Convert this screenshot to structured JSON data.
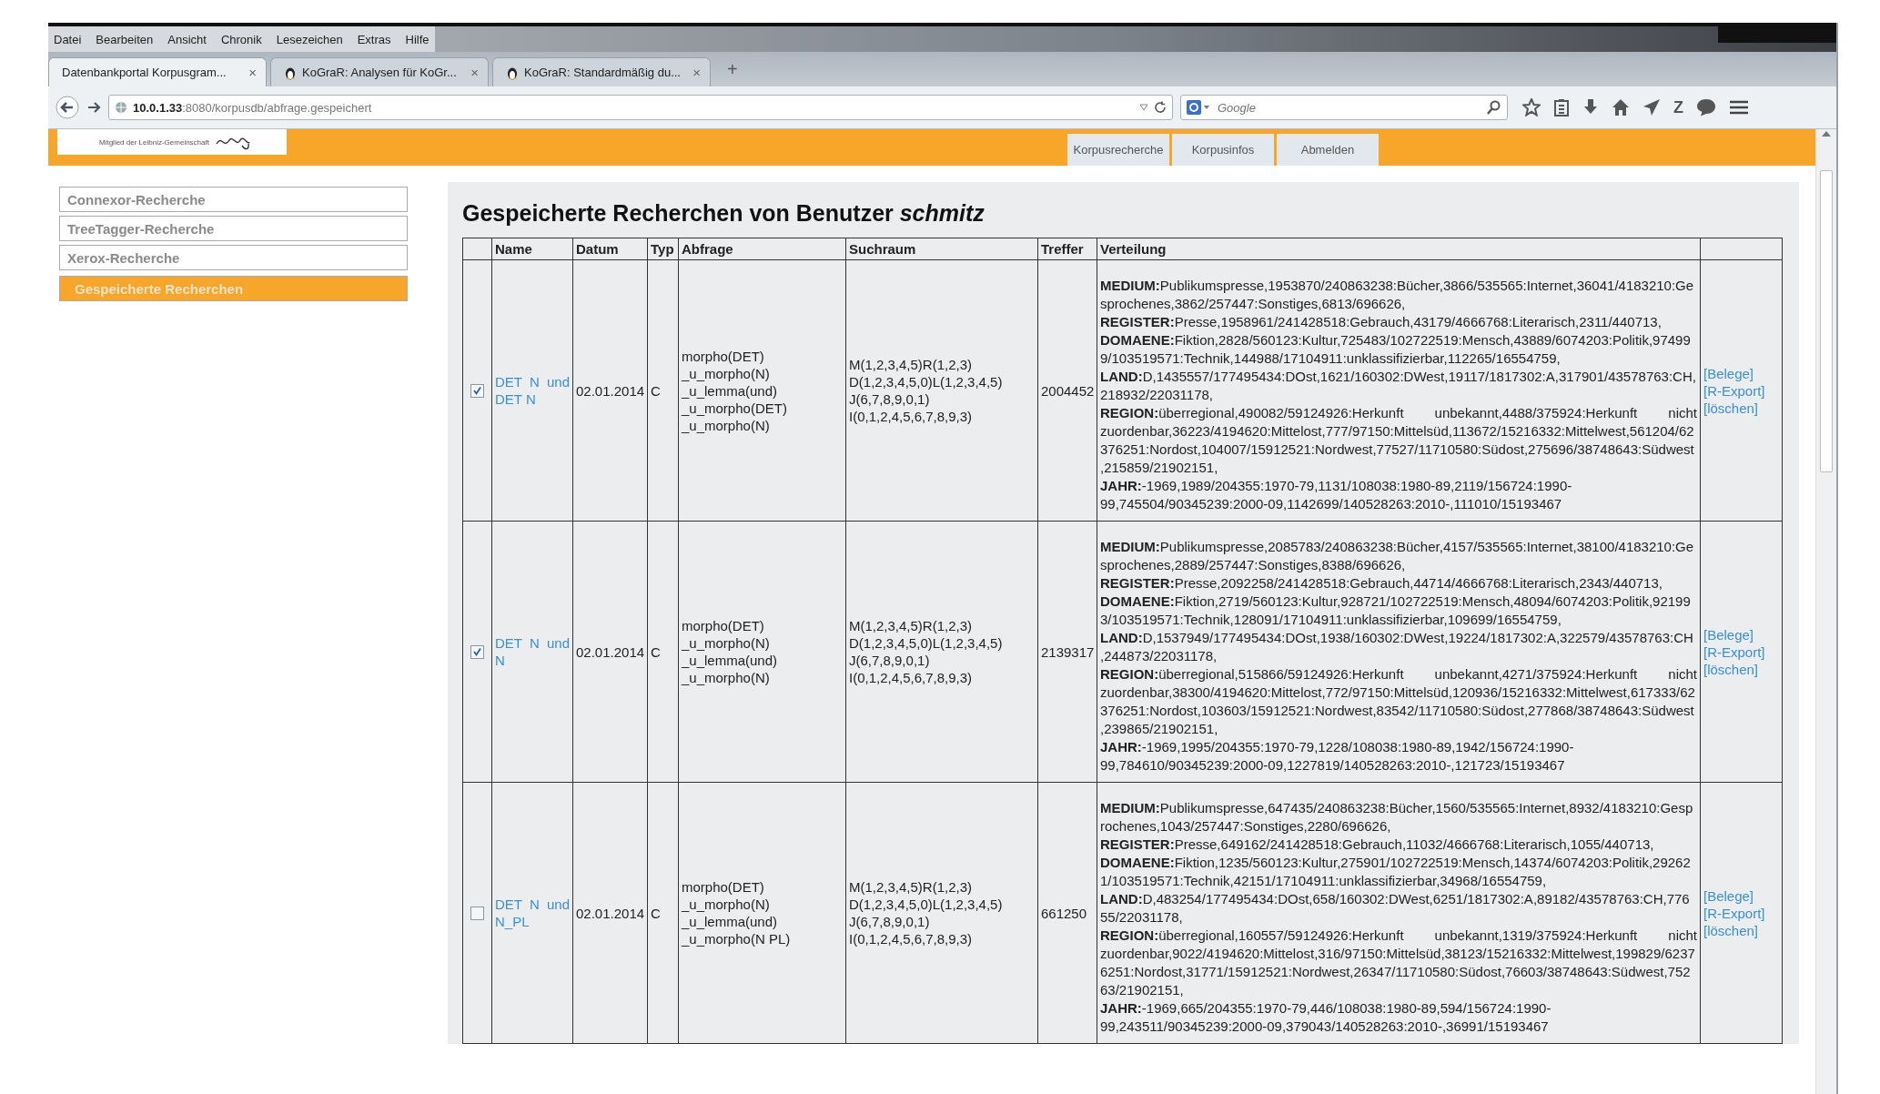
{
  "browser": {
    "menu": [
      "Datei",
      "Bearbeiten",
      "Ansicht",
      "Chronik",
      "Lesezeichen",
      "Extras",
      "Hilfe"
    ],
    "tabs": [
      {
        "title": "Datenbankportal Korpusgram...",
        "close": "×",
        "selected": true,
        "favicon": false
      },
      {
        "title": "KoGraR: Analysen für KoGr...",
        "close": "×",
        "selected": false,
        "favicon": true
      },
      {
        "title": "KoGraR: Standardmäßig du...",
        "close": "×",
        "selected": false,
        "favicon": true
      }
    ],
    "new_tab": "+",
    "url": {
      "host": "10.0.1.33",
      "path": ":8080/korpusdb/abfrage.gespeichert"
    },
    "search": {
      "placeholder": "Google"
    },
    "addon_label": "Z"
  },
  "header": {
    "logo_caption": "Mitglied der Leibniz-Gemeinschaft",
    "nav": [
      "Korpusrecherche",
      "Korpusinfos",
      "Abmelden"
    ]
  },
  "sidebar": {
    "items": [
      {
        "label": "Connexor-Recherche",
        "selected": false
      },
      {
        "label": "TreeTagger-Recherche",
        "selected": false
      },
      {
        "label": "Xerox-Recherche",
        "selected": false
      },
      {
        "label": "Gespeicherte Recherchen",
        "selected": true
      }
    ]
  },
  "page": {
    "title": "Gespeicherte Recherchen von Benutzer *schmitz*"
  },
  "table": {
    "columns": [
      "Name",
      "Datum",
      "Typ",
      "Abfrage",
      "Suchraum",
      "Treffer",
      "Verteilung"
    ],
    "rows": [
      {
        "checked": true,
        "name": "DET N und DET N",
        "datum": "02.01.2014",
        "typ": "C",
        "abfrage": [
          "morpho(DET)",
          "_u_morpho(N)",
          "_u_lemma(und)",
          "_u_morpho(DET)",
          "_u_morpho(N)"
        ],
        "suchraum": [
          "M(1,2,3,4,5)R(1,2,3)",
          "D(1,2,3,4,5,0)L(1,2,3,4,5)",
          "J(6,7,8,9,0,1)",
          "I(0,1,2,4,5,6,7,8,9,3)"
        ],
        "treffer": "2004452",
        "verteilung": [
          "**MEDIUM:**Publikumspresse,1953870/240863238:Bücher,3866/535565:Internet,36041/4183210:Gesprochenes,3862/257447:Sonstiges,6813/696626,",
          "**REGISTER:**Presse,1958961/241428518:Gebrauch,43179/4666768:Literarisch,2311/440713,",
          "**DOMAENE:**Fiktion,2828/560123:Kultur,725483/102722519:Mensch,43889/6074203:Politik,974999/103519571:Technik,144988/17104911:unklassifizierbar,112265/16554759,",
          "**LAND:**D,1435557/177495434:DOst,1621/160302:DWest,19117/1817302:A,317901/43578763:CH,218932/22031178,",
          "**REGION:**überregional,490082/59124926:Herkunft unbekannt,4488/375924:Herkunft nicht zuordenbar,36223/4194620:Mittelost,777/97150:Mittelsüd,113672/15216332:Mittelwest,561204/62376251:Nordost,104007/15912521:Nordwest,77527/11710580:Südost,275696/38748643:Südwest,215859/21902151,",
          "**JAHR:**-1969,1989/204355:1970-79,1131/108038:1980-89,2119/156724:1990-99,745504/90345239:2000-09,1142699/140528263:2010-,111010/15193467"
        ],
        "actions": [
          "[Belege]",
          "[R-Export]",
          "[löschen]"
        ]
      },
      {
        "checked": true,
        "name": "DET N und N",
        "datum": "02.01.2014",
        "typ": "C",
        "abfrage": [
          "morpho(DET)",
          "_u_morpho(N)",
          "_u_lemma(und)",
          "_u_morpho(N)"
        ],
        "suchraum": [
          "M(1,2,3,4,5)R(1,2,3)",
          "D(1,2,3,4,5,0)L(1,2,3,4,5)",
          "J(6,7,8,9,0,1)",
          "I(0,1,2,4,5,6,7,8,9,3)"
        ],
        "treffer": "2139317",
        "verteilung": [
          "**MEDIUM:**Publikumspresse,2085783/240863238:Bücher,4157/535565:Internet,38100/4183210:Gesprochenes,2889/257447:Sonstiges,8388/696626,",
          "**REGISTER:**Presse,2092258/241428518:Gebrauch,44714/4666768:Literarisch,2343/440713,",
          "**DOMAENE:**Fiktion,2719/560123:Kultur,928721/102722519:Mensch,48094/6074203:Politik,921993/103519571:Technik,128091/17104911:unklassifizierbar,109699/16554759,",
          "**LAND:**D,1537949/177495434:DOst,1938/160302:DWest,19224/1817302:A,322579/43578763:CH,244873/22031178,",
          "**REGION:**überregional,515866/59124926:Herkunft unbekannt,4271/375924:Herkunft nicht zuordenbar,38300/4194620:Mittelost,772/97150:Mittelsüd,120936/15216332:Mittelwest,617333/62376251:Nordost,103603/15912521:Nordwest,83542/11710580:Südost,277868/38748643:Südwest,239865/21902151,",
          "**JAHR:**-1969,1995/204355:1970-79,1228/108038:1980-89,1942/156724:1990-99,784610/90345239:2000-09,1227819/140528263:2010-,121723/15193467"
        ],
        "actions": [
          "[Belege]",
          "[R-Export]",
          "[löschen]"
        ]
      },
      {
        "checked": false,
        "name": "DET N und N_PL",
        "datum": "02.01.2014",
        "typ": "C",
        "abfrage": [
          "morpho(DET)",
          "_u_morpho(N)",
          "_u_lemma(und)",
          "_u_morpho(N PL)"
        ],
        "suchraum": [
          "M(1,2,3,4,5)R(1,2,3)",
          "D(1,2,3,4,5,0)L(1,2,3,4,5)",
          "J(6,7,8,9,0,1)",
          "I(0,1,2,4,5,6,7,8,9,3)"
        ],
        "treffer": "661250",
        "verteilung": [
          "**MEDIUM:**Publikumspresse,647435/240863238:Bücher,1560/535565:Internet,8932/4183210:Gesprochenes,1043/257447:Sonstiges,2280/696626,",
          "**REGISTER:**Presse,649162/241428518:Gebrauch,11032/4666768:Literarisch,1055/440713,",
          "**DOMAENE:**Fiktion,1235/560123:Kultur,275901/102722519:Mensch,14374/6074203:Politik,292621/103519571:Technik,42151/17104911:unklassifizierbar,34968/16554759,",
          "**LAND:**D,483254/177495434:DOst,658/160302:DWest,6251/1817302:A,89182/43578763:CH,77655/22031178,",
          "**REGION:**überregional,160557/59124926:Herkunft unbekannt,1319/375924:Herkunft nicht zuordenbar,9022/4194620:Mittelost,316/97150:Mittelsüd,38123/15216332:Mittelwest,199829/62376251:Nordost,31771/15912521:Nordwest,26347/11710580:Südost,76603/38748643:Südwest,75263/21902151,",
          "**JAHR:**-1969,665/204355:1970-79,446/108038:1980-89,594/156724:1990-99,243511/90345239:2000-09,379043/140528263:2010-,36991/15193467"
        ],
        "actions": [
          "[Belege]",
          "[R-Export]",
          "[löschen]"
        ]
      }
    ]
  }
}
